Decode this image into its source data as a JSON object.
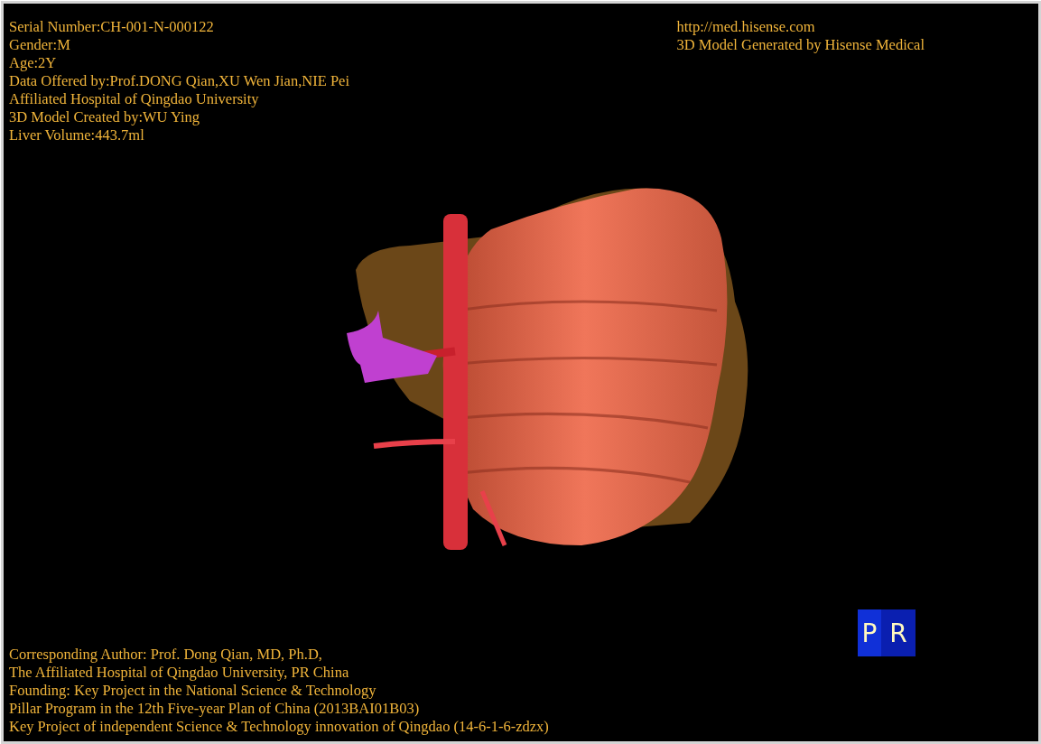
{
  "info_top_left": [
    "Serial Number:CH-001-N-000122",
    "Gender:M",
    "Age:2Y",
    "Data Offered by:Prof.DONG Qian,XU Wen Jian,NIE Pei",
    "Affiliated Hospital of Qingdao University",
    "3D Model Created by:WU Ying",
    "Liver Volume:443.7ml"
  ],
  "info_top_right": [
    "http://med.hisense.com",
    "3D Model Generated by Hisense Medical"
  ],
  "info_bottom": [
    "Corresponding Author: Prof. Dong Qian, MD, Ph.D,",
    "The Affiliated Hospital of Qingdao University, PR China",
    "Founding: Key Project in the National Science & Technology",
    "Pillar Program in the 12th Five-year Plan of China (2013BAI01B03)",
    "Key Project of independent Science & Technology innovation of Qingdao (14-6-1-6-zdzx)"
  ],
  "orientation_cube": {
    "front_label": "P",
    "side_label": "R"
  }
}
